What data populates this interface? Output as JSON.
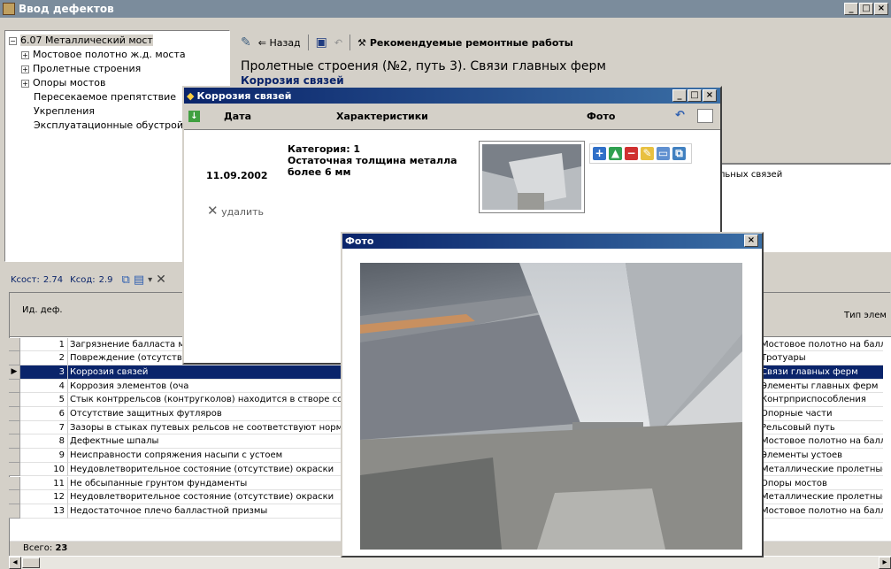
{
  "main_window": {
    "title": "Ввод дефектов"
  },
  "tree": {
    "root": "6.07 Металлический мост",
    "items": [
      "Мостовое полотно ж.д. моста",
      "Пролетные строения",
      "Опоры мостов",
      "Пересекаемое препятствие",
      "Укрепления",
      "Эксплуатационные обустрой"
    ]
  },
  "toolbar": {
    "back_label": "Назад",
    "recommend_label": "Рекомендуемые ремонтные работы"
  },
  "heading": {
    "title": "Пролетные строения (№2, путь 3). Связи главных ферм",
    "subtitle": "Коррозия связей"
  },
  "right_panel": {
    "text": "льных связей"
  },
  "stats": {
    "kcost_label": "Kсост:",
    "kcost_value": "2.74",
    "kcod_label": "Kсод:",
    "kcod_value": "2.9"
  },
  "grid": {
    "header_id": "Ид. деф.",
    "header_type": "Тип элем",
    "rows": [
      {
        "id": "1",
        "name": "Загрязнение балласта мо",
        "type": "Мостовое полотно на балл"
      },
      {
        "id": "2",
        "name": "Повреждение (отсутствие",
        "type": "Тротуары"
      },
      {
        "id": "3",
        "name": "Коррозия связей",
        "type": "Связи главных ферм"
      },
      {
        "id": "4",
        "name": "Коррозия элементов (оча",
        "type": "Элементы главных ферм"
      },
      {
        "id": "5",
        "name": "Стык контррельсов (контругколов) находится в створе со с",
        "type": "Контрприспособления"
      },
      {
        "id": "6",
        "name": "Отсутствие защитных футляров",
        "type": "Опорные части"
      },
      {
        "id": "7",
        "name": "Зазоры в стыках путевых рельсов не соответствуют нормат",
        "type": "Рельсовый путь"
      },
      {
        "id": "8",
        "name": "Дефектные шпалы",
        "type": "Мостовое полотно на балл"
      },
      {
        "id": "9",
        "name": "Неисправности сопряжения насыпи с устоем",
        "type": "Элементы устоев"
      },
      {
        "id": "10",
        "name": "Неудовлетворительное состояние (отсутствие) окраски",
        "type": "Металлические пролетные"
      },
      {
        "id": "11",
        "name": "Не обсыпанные грунтом фундаменты",
        "type": "Опоры мостов"
      },
      {
        "id": "12",
        "name": "Неудовлетворительное состояние (отсутствие) окраски",
        "type": "Металлические пролетные"
      },
      {
        "id": "13",
        "name": "Недостаточное плечо балластной призмы",
        "type": "Мостовое полотно на балл"
      }
    ],
    "selected_row": 2,
    "total_label": "Всего:",
    "total_value": "23"
  },
  "corrosion_dialog": {
    "title": "Коррозия связей",
    "col_date": "Дата",
    "col_chars": "Характеристики",
    "col_photo": "Фото",
    "date": "11.09.2002",
    "chars_line1": "Категория: 1",
    "chars_line2": "Остаточная толщина металла",
    "chars_line3": "более 6 мм",
    "delete_label": "удалить"
  },
  "photo_dialog": {
    "title": "Фото"
  },
  "colors": {
    "accent": "#0a246a",
    "selection": "#0a246a",
    "inactive_title": "#7b8c9c"
  }
}
